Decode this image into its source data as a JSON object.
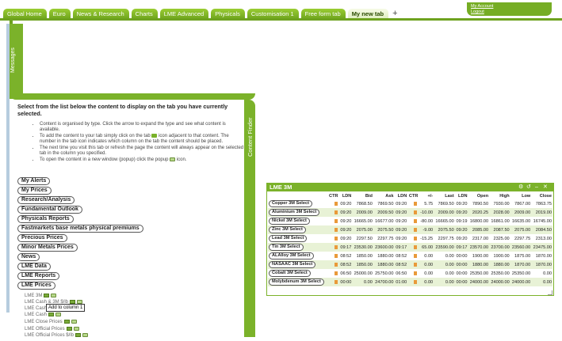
{
  "tabs": [
    "Global Home",
    "Euro",
    "News & Research",
    "Charts",
    "LME Advanced",
    "Physicals",
    "Customisation 1",
    "Free form tab",
    "My new tab"
  ],
  "plus": "+",
  "account": {
    "my_account": "My Account",
    "logout": "Logout"
  },
  "messages_label": "Messages",
  "content_finder_label": "Content Finder",
  "intro": "Select from the list below the content to display on the tab you have currently selected.",
  "bullets": [
    "Content is organised by type. Click the arrow to expand the type and see what content is available.",
    "To add the content to your tab simply click on the tab",
    "icon adjacent to that content. The number in the tab icon indicates which column on the tab the content should be placed.",
    "The next time you visit this tab or refresh the page the content will always appear on the selected tab in the column you specified.",
    "To open the content in a new window (popup) click the popup",
    "icon."
  ],
  "categories": [
    "My Alerts",
    "My Prices",
    "Research/Analysis",
    "Fundamental Outlook",
    "Physicals Reports",
    "Fastmarkets base metals physical premiums",
    "Precious Prices",
    "Minor Metals Prices",
    "News",
    "LME Data",
    "LME Reports",
    "LME Prices"
  ],
  "lme_prices_items": [
    "LME 3M",
    "LME Cash & 3M $/lb",
    "LME Cash",
    "LME Cash",
    "LME Close Prices",
    "LME Official Prices",
    "LME Official Prices $/lb"
  ],
  "tooltip": "Add to column 1",
  "lme3m": {
    "title": "LME 3M",
    "controls": [
      "⚙",
      "↺",
      "–",
      "✕"
    ],
    "headers": [
      "",
      "CTR",
      "LDN",
      "Bid",
      "Ask",
      "LDN",
      "CTR",
      "+/-",
      "Last",
      "LDN",
      "Open",
      "High",
      "Low",
      "Close"
    ],
    "rows": [
      [
        "Copper 3M Select",
        "",
        "09:20",
        "7868.50",
        "7869.50",
        "09:20",
        "",
        "5.75",
        "7869.50",
        "09:20",
        "7890.50",
        "7930.00",
        "7867.00",
        "7863.75"
      ],
      [
        "Aluminium 3M Select",
        "",
        "09:20",
        "2009.00",
        "2009.50",
        "09:20",
        "",
        "-10.00",
        "2009.00",
        "09:20",
        "2020.25",
        "2028.00",
        "2009.00",
        "2019.00"
      ],
      [
        "Nickel 3M Select",
        "",
        "09:20",
        "16665.00",
        "16677.00",
        "09:20",
        "",
        "-80.00",
        "16665.00",
        "09:19",
        "16800.00",
        "16861.00",
        "16635.00",
        "16745.00"
      ],
      [
        "Zinc 3M Select",
        "",
        "09:20",
        "2075.00",
        "2075.50",
        "09:20",
        "",
        "-9.00",
        "2075.50",
        "09:20",
        "2085.00",
        "2087.50",
        "2075.00",
        "2084.50"
      ],
      [
        "Lead 3M Select",
        "",
        "09:20",
        "2297.50",
        "2297.75",
        "09:20",
        "",
        "-15.25",
        "2297.75",
        "09:20",
        "2317.00",
        "2325.00",
        "2297.75",
        "2313.00"
      ],
      [
        "Tin 3M Select",
        "",
        "09:17",
        "23530.00",
        "23600.00",
        "09:17",
        "",
        "65.00",
        "23590.00",
        "09:17",
        "23570.00",
        "23700.00",
        "23560.00",
        "23475.00"
      ],
      [
        "ALAlloy 3M Select",
        "",
        "08:52",
        "1850.00",
        "1880.00",
        "08:52",
        "",
        "0.00",
        "0.00",
        "00:00",
        "1900.00",
        "1900.00",
        "1875.00",
        "1870.00"
      ],
      [
        "NASAAC 3M Select",
        "",
        "08:52",
        "1850.00",
        "1880.00",
        "08:52",
        "",
        "0.00",
        "0.00",
        "00:00",
        "1880.00",
        "1880.00",
        "1870.00",
        "1870.00"
      ],
      [
        "Cobalt 3M Select",
        "",
        "06:50",
        "25000.00",
        "25750.00",
        "06:50",
        "",
        "0.00",
        "0.00",
        "00:00",
        "25350.00",
        "25350.00",
        "25350.00",
        "0.00"
      ],
      [
        "Molybdenum 3M Select",
        "",
        "00:00",
        "0.00",
        "24700.00",
        "01:00",
        "",
        "0.00",
        "0.00",
        "00:00",
        "24000.00",
        "24000.00",
        "24000.00",
        "0.00"
      ]
    ]
  },
  "colors": {
    "brand_green": "#7bb22a",
    "flag_orange": "#e99a3a"
  }
}
